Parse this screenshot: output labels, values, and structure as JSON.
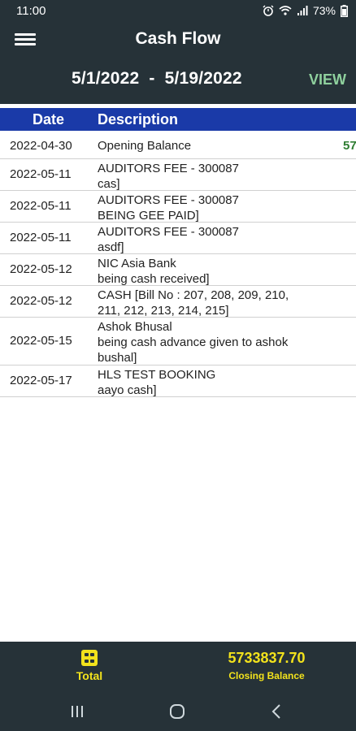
{
  "status": {
    "time": "11:00",
    "battery": "73%"
  },
  "appbar": {
    "title": "Cash Flow",
    "from_date": "5/1/2022",
    "separator": "-",
    "to_date": "5/19/2022",
    "view_label": "VIEW"
  },
  "table": {
    "headers": {
      "date": "Date",
      "description": "Description"
    },
    "rows": [
      {
        "date": "2022-04-30",
        "line1": "Opening Balance",
        "line2": "",
        "amount": "57"
      },
      {
        "date": "2022-05-11",
        "line1": "AUDITORS FEE - 300087",
        "line2": "cas]",
        "amount": ""
      },
      {
        "date": "2022-05-11",
        "line1": "AUDITORS FEE - 300087",
        "line2": "BEING GEE PAID]",
        "amount": ""
      },
      {
        "date": "2022-05-11",
        "line1": "AUDITORS FEE - 300087",
        "line2": "asdf]",
        "amount": ""
      },
      {
        "date": "2022-05-12",
        "line1": "NIC Asia Bank",
        "line2": "being cash received]",
        "amount": ""
      },
      {
        "date": "2022-05-12",
        "line1": "CASH [Bill No :  207, 208, 209, 210,",
        "line2": "211, 212, 213, 214, 215]",
        "amount": ""
      },
      {
        "date": "2022-05-15",
        "line1": "Ashok Bhusal",
        "line2": "being cash advance given to ashok",
        "line3": "bushal]",
        "amount": ""
      },
      {
        "date": "2022-05-17",
        "line1": "HLS TEST BOOKING",
        "line2": "aayo cash]",
        "amount": ""
      }
    ]
  },
  "footer": {
    "total_label": "Total",
    "closing_value": "5733837.70",
    "closing_label": "Closing Balance"
  },
  "colors": {
    "header_bg": "#263238",
    "table_header_bg": "#1a3aa8",
    "accent_yellow": "#f2e21c",
    "view_green": "#8fd19e",
    "amount_green": "#2e7d32"
  },
  "icons": {
    "menu": "hamburger-icon",
    "total": "grid-icon",
    "nav_recent": "recent-apps-icon",
    "nav_home": "home-icon",
    "nav_back": "back-icon"
  }
}
